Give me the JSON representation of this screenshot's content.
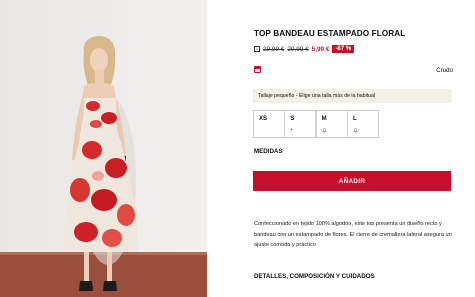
{
  "product": {
    "title": "TOP BANDEAU ESTAMPADO FLORAL",
    "price_old_1": "29,99 €",
    "price_old_2": "20,99 €",
    "price_new": "5,99 €",
    "discount": "-87 %",
    "info_icon": "info-icon",
    "color_name": "Crudo",
    "colors": {
      "accent": "#c8102e",
      "note_bg": "#f3f0e8"
    }
  },
  "size_note": "Tallaje pequeño - Elige una talla más de la habitual",
  "sizes": [
    {
      "label": "XS",
      "status_icon": ""
    },
    {
      "label": "S",
      "status_icon": "dot-icon"
    },
    {
      "label": "M",
      "status_icon": "bell-icon"
    },
    {
      "label": "L",
      "status_icon": "bell-icon"
    }
  ],
  "measures_label": "MEDIDAS",
  "add_button_label": "AÑADIR",
  "description": "Confeccionado en tejido 100% algodón, este top presenta un diseño recto y bandeau con un estampado de flores. El cierre de cremallera lateral asegura un ajuste cómodo y práctico",
  "details_label": "DETALLES, COMPOSICIÓN Y CUIDADOS"
}
